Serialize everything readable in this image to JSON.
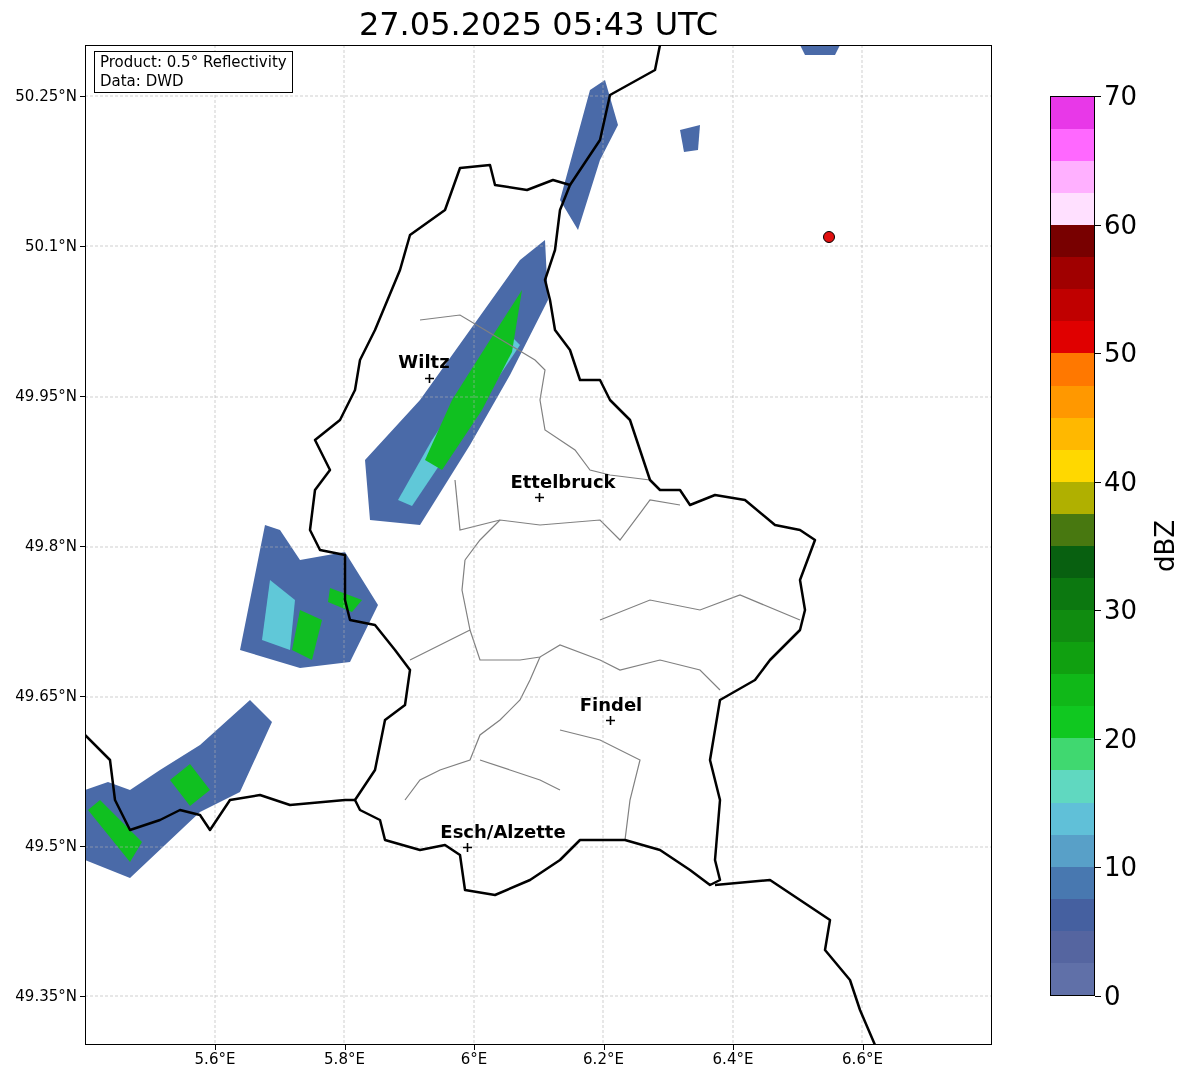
{
  "title": "27.05.2025 05:43 UTC",
  "map": {
    "info_box": [
      "Product: 0.5° Reflectivity",
      "Data: DWD"
    ],
    "y_ticks": [
      "50.25°N",
      "50.1°N",
      "49.95°N",
      "49.8°N",
      "49.65°N",
      "49.5°N",
      "49.35°N"
    ],
    "x_ticks": [
      "5.6°E",
      "5.8°E",
      "6°E",
      "6.2°E",
      "6.4°E",
      "6.6°E"
    ],
    "cities": [
      {
        "name": "Wiltz"
      },
      {
        "name": "Ettelbruck"
      },
      {
        "name": "Findel"
      },
      {
        "name": "Esch/Alzette"
      }
    ]
  },
  "colorbar": {
    "label": "dBZ",
    "ticks": [
      "70",
      "60",
      "50",
      "40",
      "30",
      "20",
      "10",
      "0"
    ],
    "bins": [
      {
        "color": "#6070a8"
      },
      {
        "color": "#5565a0"
      },
      {
        "color": "#4560a0"
      },
      {
        "color": "#4878b0"
      },
      {
        "color": "#58a0c8"
      },
      {
        "color": "#60c0d8"
      },
      {
        "color": "#60d8c0"
      },
      {
        "color": "#40d870"
      },
      {
        "color": "#10c820"
      },
      {
        "color": "#10b818"
      },
      {
        "color": "#10a010"
      },
      {
        "color": "#108c10"
      },
      {
        "color": "#0c7810"
      },
      {
        "color": "#086010"
      },
      {
        "color": "#487810"
      },
      {
        "color": "#b0b000"
      },
      {
        "color": "#ffd800"
      },
      {
        "color": "#ffb800"
      },
      {
        "color": "#ff9800"
      },
      {
        "color": "#ff7800"
      },
      {
        "color": "#e00000"
      },
      {
        "color": "#c00000"
      },
      {
        "color": "#a00000"
      },
      {
        "color": "#780000"
      },
      {
        "color": "#ffe0ff"
      },
      {
        "color": "#ffb0ff"
      },
      {
        "color": "#ff68ff"
      },
      {
        "color": "#e838e8"
      }
    ]
  }
}
